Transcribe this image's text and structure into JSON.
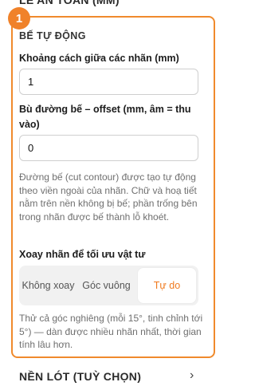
{
  "top_section": {
    "title": "LỀ AN TOÀN (MM)"
  },
  "step": {
    "number": "1"
  },
  "die_cut": {
    "title": "BẾ TỰ ĐỘNG",
    "label_gap": {
      "label": "Khoảng cách giữa các nhãn (mm)",
      "value": "1"
    },
    "offset": {
      "label": "Bù đường bế – offset (mm, âm = thu vào)",
      "value": "0"
    },
    "help": "Đường bế (cut contour) được tạo tự động theo viền ngoài của nhãn. Chữ và hoạ tiết nằm trên nền không bị bế; phần trống bên trong nhãn được bế thành lỗ khoét.",
    "rotation": {
      "label": "Xoay nhãn để tối ưu vật tư",
      "options": [
        "Không xoay",
        "Góc vuông",
        "Tự do"
      ],
      "selected": "Tự do",
      "help": "Thử cả góc nghiêng (mỗi 15°, tinh chỉnh tới 5°) — dàn được nhiều nhãn nhất, thời gian tính lâu hơn."
    }
  },
  "bottom_section": {
    "title": "NỀN LÓT (TUỲ CHỌN)"
  }
}
